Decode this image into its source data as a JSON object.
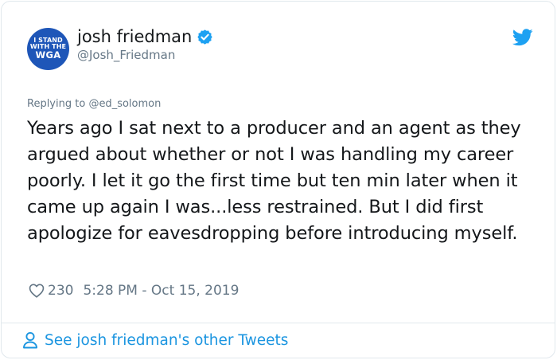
{
  "author": {
    "avatar_lines": [
      "I STAND",
      "WITH THE",
      "WGA"
    ],
    "display_name": "josh friedman",
    "handle": "@Josh_Friedman"
  },
  "reply": {
    "prefix": "Replying to",
    "to_handle": "@ed_solomon"
  },
  "tweet": {
    "text": "Years ago I sat next to a producer and an agent as they argued about whether or not I was handling my career poorly. I let it go the first time but ten min later when it came up again I was...less restrained. But I did first apologize for eavesdropping before introducing myself.",
    "likes": "230",
    "timestamp": "5:28 PM - Oct 15, 2019"
  },
  "footer": {
    "link_label": "See josh friedman's other Tweets"
  },
  "icons": {
    "verified": "verified-badge-icon",
    "bird": "twitter-bird-icon",
    "heart": "heart-icon",
    "person": "person-icon"
  },
  "colors": {
    "accent": "#1b95e0",
    "avatar_bg": "#1e56b8",
    "text": "#14171a",
    "secondary": "#657786",
    "border": "#e1e8ed"
  }
}
